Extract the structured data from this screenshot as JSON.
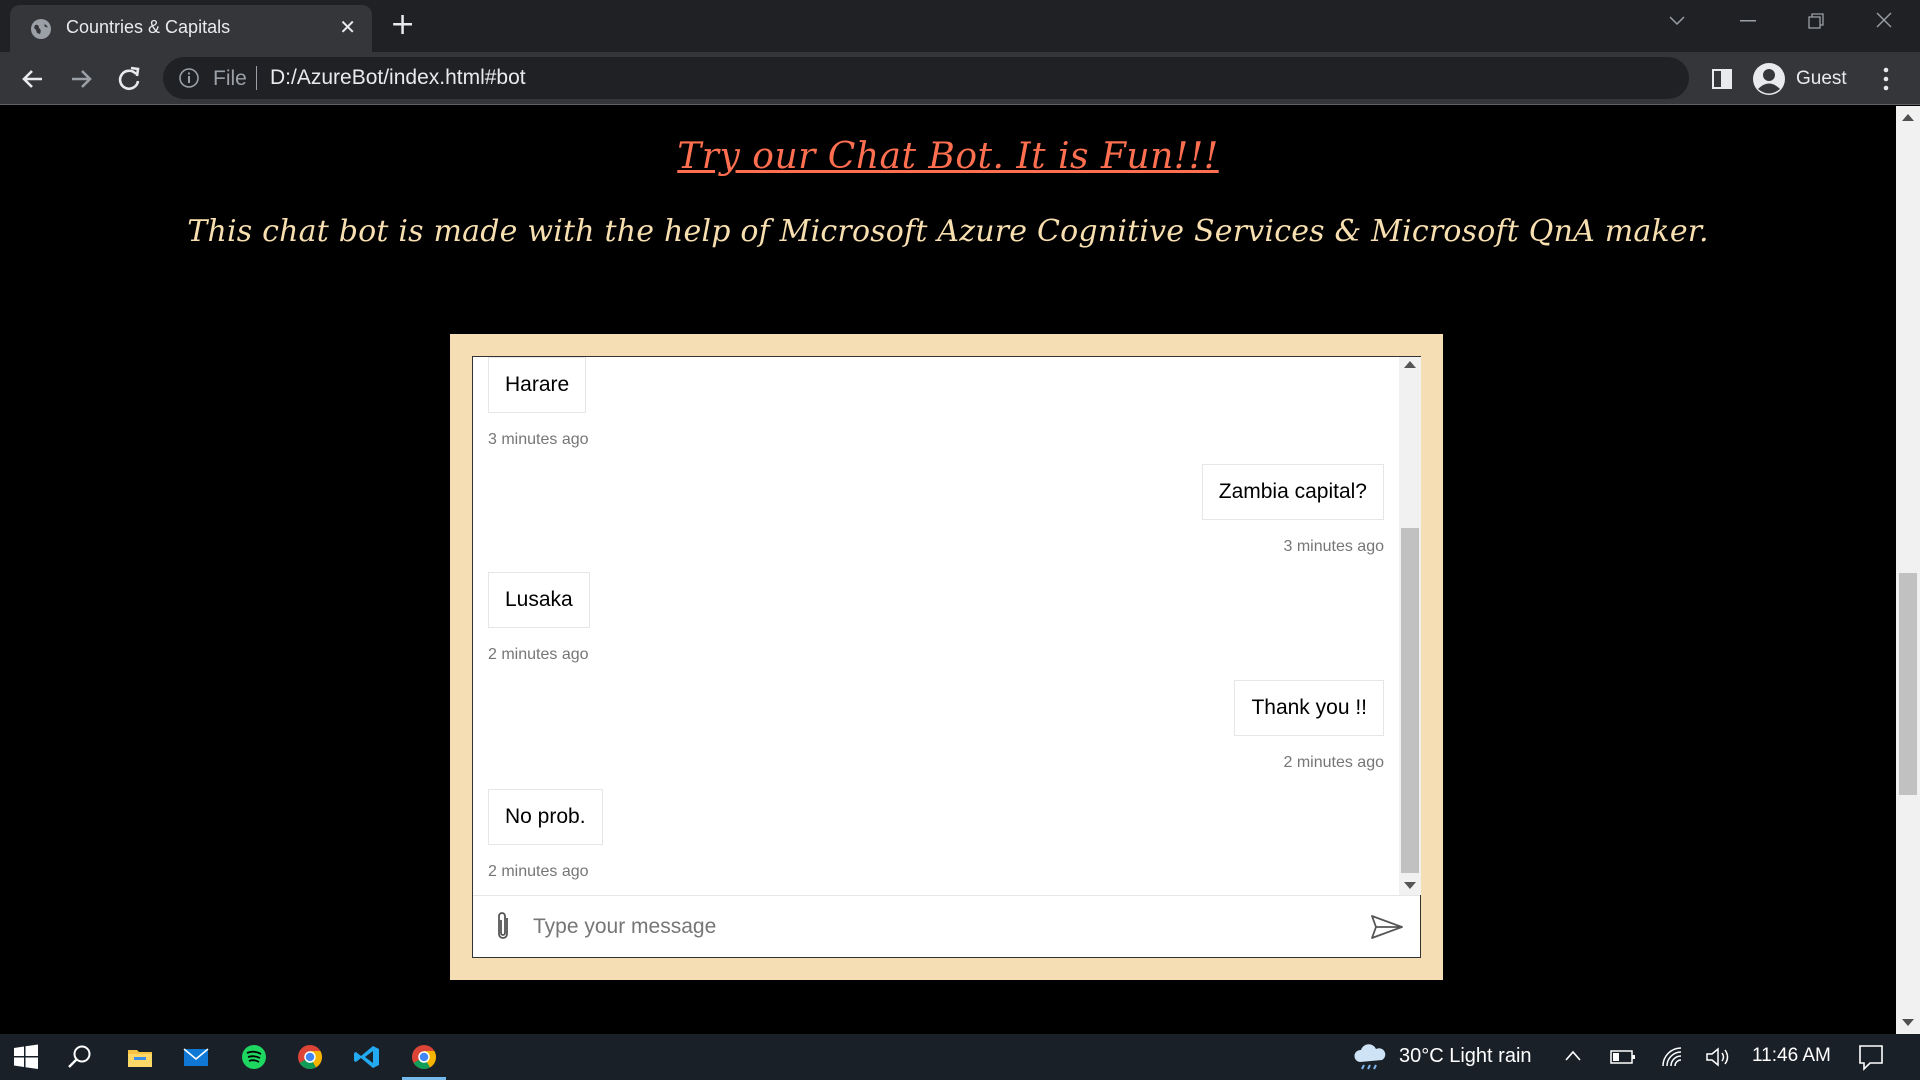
{
  "browser": {
    "tab_title": "Countries & Capitals",
    "url_scheme": "File",
    "url": "D:/AzureBot/index.html#bot",
    "profile_name": "Guest"
  },
  "page": {
    "headline": "Try our Chat Bot. It is Fun!!!",
    "subline": "This chat bot is made with the help of Microsoft Azure Cognitive Services & Microsoft QnA maker."
  },
  "chat": {
    "messages": [
      {
        "from": "bot",
        "text": "Harare",
        "time": "3 minutes ago"
      },
      {
        "from": "user",
        "text": "Zambia capital?",
        "time": "3 minutes ago"
      },
      {
        "from": "bot",
        "text": "Lusaka",
        "time": "2 minutes ago"
      },
      {
        "from": "user",
        "text": "Thank you !!",
        "time": "2 minutes ago"
      },
      {
        "from": "bot",
        "text": "No prob.",
        "time": "2 minutes ago"
      }
    ],
    "input_placeholder": "Type your message",
    "frame_color": "#f5deb3"
  },
  "taskbar": {
    "weather": "30°C  Light rain",
    "clock": "11:46 AM"
  },
  "colors": {
    "headline": "#ff6f50",
    "subline": "#f8dfb0",
    "chrome_dark": "#202124",
    "chrome_tab": "#35363a"
  }
}
